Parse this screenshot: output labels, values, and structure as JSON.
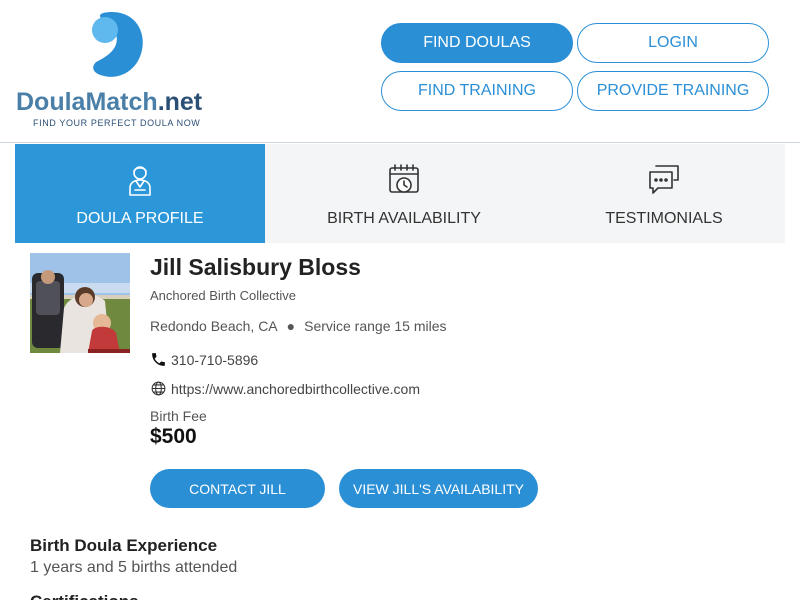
{
  "brand": {
    "name_main": "DoulaMatch",
    "name_tld": ".net",
    "tagline": "FIND YOUR PERFECT DOULA NOW",
    "colors": {
      "primary": "#2b8fd6",
      "dark_blue": "#2b4f75",
      "mid_blue": "#4a7fa8",
      "light_blue": "#5fb8ee"
    }
  },
  "nav": {
    "find_doulas": "FIND DOULAS",
    "login": "LOGIN",
    "find_training": "FIND TRAINING",
    "provide_training": "PROVIDE TRAINING"
  },
  "tabs": [
    {
      "label": "DOULA PROFILE",
      "icon": "person-icon",
      "active": true
    },
    {
      "label": "BIRTH AVAILABILITY",
      "icon": "calendar-clock-icon",
      "active": false
    },
    {
      "label": "TESTIMONIALS",
      "icon": "chat-bubbles-icon",
      "active": false
    }
  ],
  "profile": {
    "name": "Jill Salisbury Bloss",
    "organization": "Anchored Birth Collective",
    "location": "Redondo Beach, CA",
    "service_range": "Service range 15 miles",
    "phone": "310-710-5896",
    "website": "https://www.anchoredbirthcollective.com",
    "fee_label": "Birth Fee",
    "fee_value": "$500",
    "contact_button": "CONTACT JILL",
    "availability_button": "VIEW JILL'S AVAILABILITY"
  },
  "experience": {
    "title": "Birth Doula Experience",
    "text": "1 years and 5 births attended"
  },
  "next_section_title": "Certifications"
}
